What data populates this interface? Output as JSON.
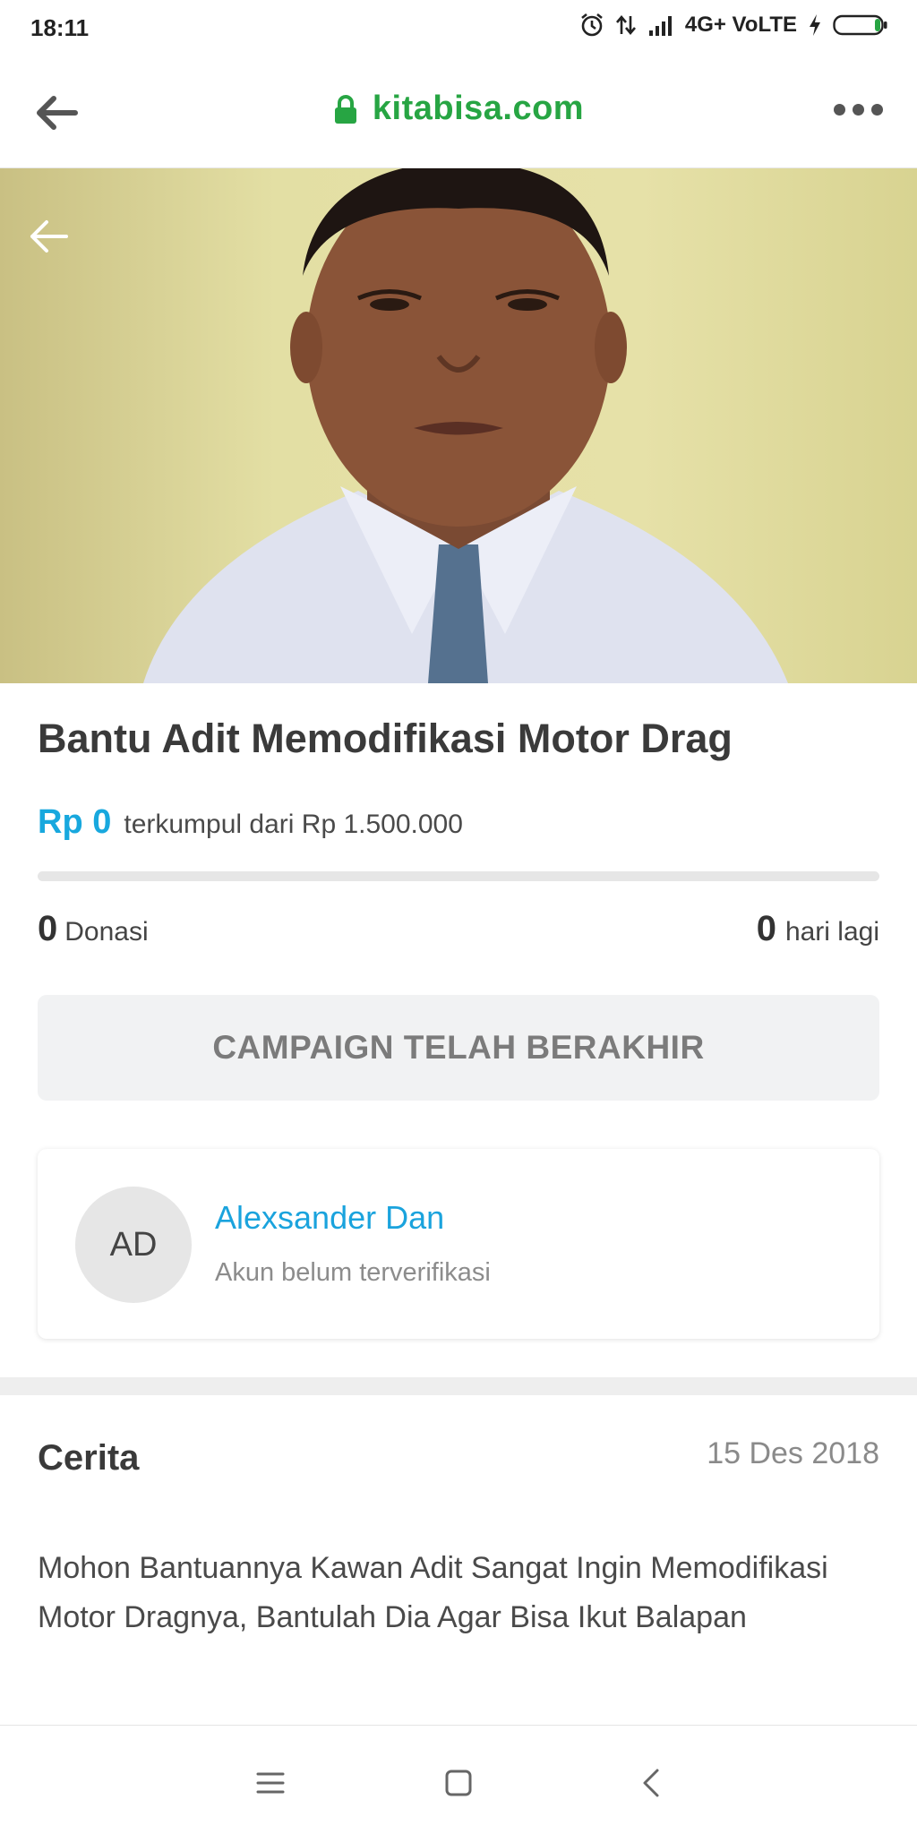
{
  "status_bar": {
    "time": "18:11",
    "network": "4G+ VoLTE",
    "icons": [
      "alarm-icon",
      "data-arrows-icon",
      "signal-icon",
      "charging-icon",
      "battery-icon"
    ]
  },
  "browser": {
    "url": "kitabisa.com",
    "url_color": "#27a543",
    "icons": [
      "back-arrow-icon",
      "lock-icon",
      "more-dots-icon"
    ]
  },
  "campaign": {
    "title": "Bantu Adit Memodifikasi Motor Drag",
    "raised": "Rp 0",
    "target_text": "terkumpul dari Rp 1.500.000",
    "progress_fraction": 0,
    "donations_count": "0",
    "donations_label": "Donasi",
    "days_count": "0",
    "days_label": "hari lagi",
    "status_button": "CAMPAIGN TELAH BERAKHIR",
    "accent_color": "#18a8de"
  },
  "creator": {
    "initials": "AD",
    "name": "Alexsander Dan",
    "verification": "Akun belum terverifikasi"
  },
  "story": {
    "heading": "Cerita",
    "date": "15 Des 2018",
    "text": "Mohon Bantuannya Kawan Adit Sangat Ingin Memodifikasi Motor Dragnya, Bantulah Dia Agar Bisa Ikut Balapan"
  },
  "nav": {
    "icons": [
      "menu-icon",
      "home-square-icon",
      "back-chevron-icon"
    ]
  }
}
